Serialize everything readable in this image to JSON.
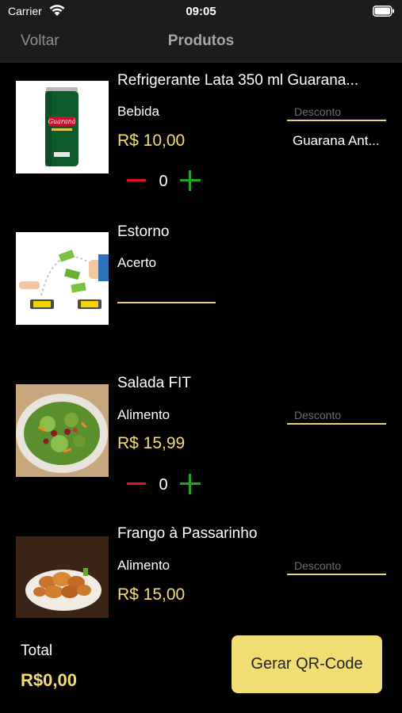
{
  "status_bar": {
    "carrier": "Carrier",
    "time": "09:05"
  },
  "nav": {
    "back_label": "Voltar",
    "title": "Produtos"
  },
  "products": [
    {
      "name": "Refrigerante Lata 350 ml Guarana...",
      "category": "Bebida",
      "price": "R$ 10,00",
      "discount_placeholder": "Desconto",
      "description": "Guarana Ant...",
      "quantity": "0"
    },
    {
      "name": "Estorno",
      "category": "Acerto"
    },
    {
      "name": "Salada FIT",
      "category": "Alimento",
      "price": "R$ 15,99",
      "discount_placeholder": "Desconto",
      "quantity": "0"
    },
    {
      "name": "Frango à Passarinho",
      "category": "Alimento",
      "price": "R$ 15,00",
      "discount_placeholder": "Desconto"
    }
  ],
  "footer": {
    "total_label": "Total",
    "total_value": "R$0,00",
    "button_label": "Gerar QR-Code"
  },
  "colors": {
    "accent_yellow": "#f2dd72",
    "minus_red": "#e0141f",
    "plus_green": "#1fa51f",
    "bar_background": "#1c1c1e"
  }
}
